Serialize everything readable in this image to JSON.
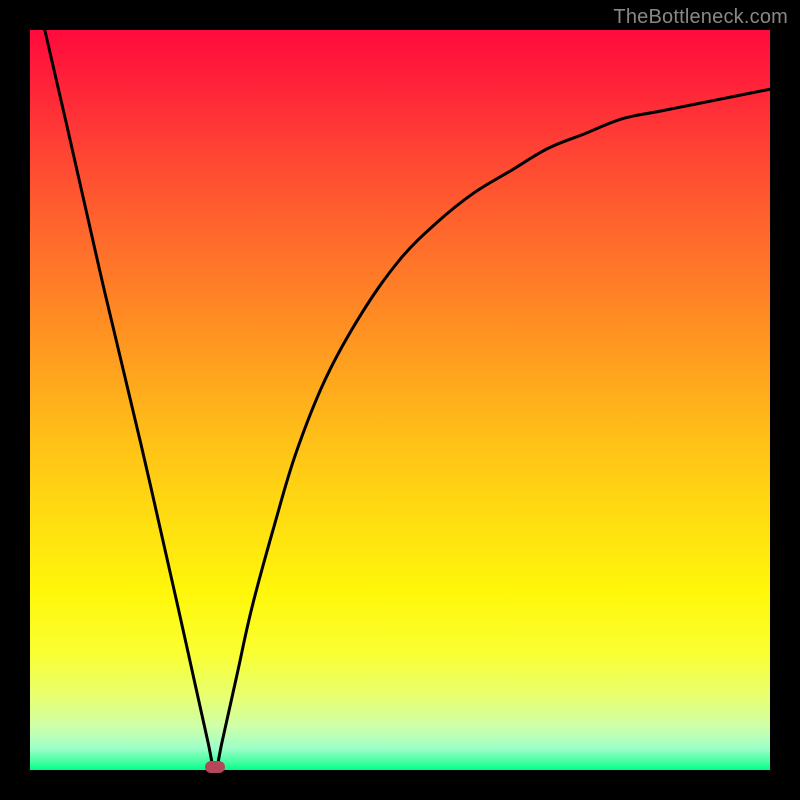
{
  "watermark": "TheBottleneck.com",
  "chart_data": {
    "type": "line",
    "title": "",
    "xlabel": "",
    "ylabel": "",
    "xlim": [
      0,
      100
    ],
    "ylim": [
      0,
      100
    ],
    "x": [
      2,
      5,
      10,
      15,
      20,
      22,
      24,
      25,
      26,
      28,
      30,
      33,
      36,
      40,
      45,
      50,
      55,
      60,
      65,
      70,
      75,
      80,
      85,
      90,
      95,
      100
    ],
    "values": [
      100,
      87,
      65,
      44,
      22,
      13,
      4,
      0,
      4,
      13,
      22,
      33,
      43,
      53,
      62,
      69,
      74,
      78,
      81,
      84,
      86,
      88,
      89,
      90,
      91,
      92
    ],
    "minimum": {
      "x": 25,
      "y": 0
    },
    "background_gradient": {
      "top": "#ff0a3c",
      "bottom": "#00ff88"
    }
  },
  "layout": {
    "plot_left": 30,
    "plot_top": 30,
    "plot_size": 740
  }
}
